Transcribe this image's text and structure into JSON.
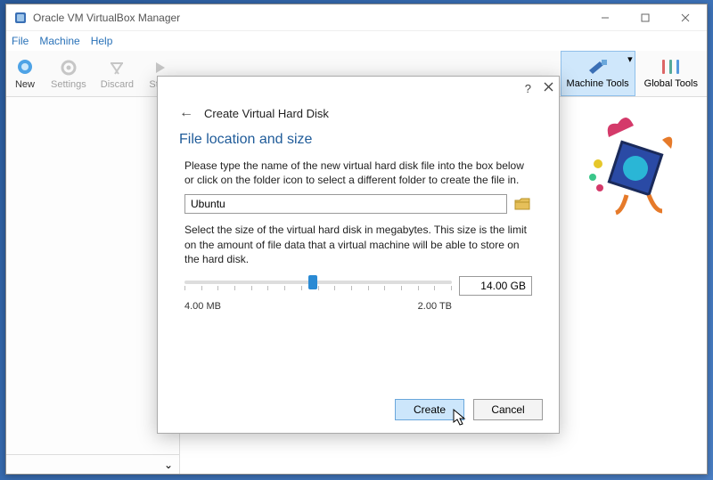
{
  "window": {
    "title": "Oracle VM VirtualBox Manager"
  },
  "menubar": {
    "file": "File",
    "machine": "Machine",
    "help": "Help"
  },
  "toolbar": {
    "new": "New",
    "settings": "Settings",
    "discard": "Discard",
    "start": "Start",
    "machine_tools": "Machine Tools",
    "global_tools": "Global Tools"
  },
  "dialog": {
    "header": "Create Virtual Hard Disk",
    "section_title": "File location and size",
    "para1": "Please type the name of the new virtual hard disk file into the box below or click on the folder icon to select a different folder to create the file in.",
    "path_value": "Ubuntu",
    "para2": "Select the size of the virtual hard disk in megabytes. This size is the limit on the amount of file data that a virtual machine will be able to store on the hard disk.",
    "size_value": "14.00 GB",
    "min_label": "4.00 MB",
    "max_label": "2.00 TB",
    "create": "Create",
    "cancel": "Cancel",
    "help": "?",
    "close": "✕"
  }
}
